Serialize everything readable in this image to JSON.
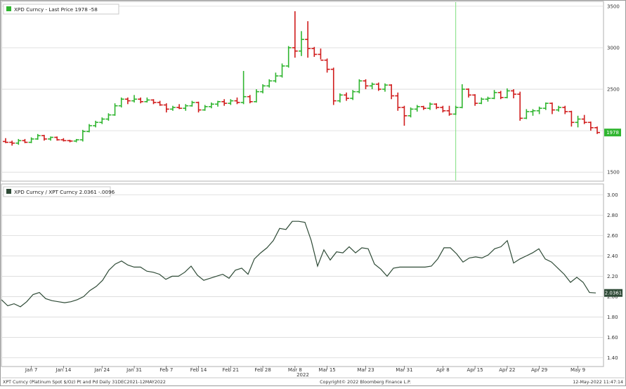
{
  "footer": {
    "left": "XPT Curncy (Platinum Spot  $/Oz) Pt and Pd  Daily 31DEC2021-12MAY2022",
    "center": "Copyright© 2022 Bloomberg Finance L.P.",
    "right": "12-May-2022 11:47:14"
  },
  "colors": {
    "up": "#2fb52f",
    "down": "#d01c1c",
    "ratio_line": "#2e4a36",
    "marker_line": "#7fe07f"
  },
  "chart_data": [
    {
      "type": "bar",
      "subtype": "ohlc",
      "title": "XPD Curncy - Last Price 1978  -58",
      "series_name": "XPD Curncy",
      "last_value_label": "1978",
      "ylim": [
        1400,
        3550
      ],
      "yticks": [
        1500,
        2000,
        2500,
        3000,
        3500
      ],
      "grid": true,
      "legend": "top-left",
      "vertical_marker_x": 70,
      "candles": [
        {
          "o": 1870,
          "h": 1910,
          "l": 1850,
          "c": 1860
        },
        {
          "o": 1860,
          "h": 1880,
          "l": 1820,
          "c": 1850
        },
        {
          "o": 1850,
          "h": 1900,
          "l": 1830,
          "c": 1880
        },
        {
          "o": 1880,
          "h": 1900,
          "l": 1850,
          "c": 1860
        },
        {
          "o": 1860,
          "h": 1920,
          "l": 1850,
          "c": 1900
        },
        {
          "o": 1900,
          "h": 1960,
          "l": 1890,
          "c": 1940
        },
        {
          "o": 1940,
          "h": 1950,
          "l": 1880,
          "c": 1900
        },
        {
          "o": 1900,
          "h": 1930,
          "l": 1880,
          "c": 1920
        },
        {
          "o": 1920,
          "h": 1930,
          "l": 1880,
          "c": 1890
        },
        {
          "o": 1890,
          "h": 1910,
          "l": 1870,
          "c": 1880
        },
        {
          "o": 1880,
          "h": 1890,
          "l": 1860,
          "c": 1875
        },
        {
          "o": 1875,
          "h": 1900,
          "l": 1860,
          "c": 1890
        },
        {
          "o": 1890,
          "h": 2010,
          "l": 1870,
          "c": 1990
        },
        {
          "o": 1990,
          "h": 2080,
          "l": 1980,
          "c": 2060
        },
        {
          "o": 2060,
          "h": 2120,
          "l": 2040,
          "c": 2100
        },
        {
          "o": 2100,
          "h": 2160,
          "l": 2080,
          "c": 2140
        },
        {
          "o": 2140,
          "h": 2210,
          "l": 2120,
          "c": 2190
        },
        {
          "o": 2190,
          "h": 2330,
          "l": 2180,
          "c": 2300
        },
        {
          "o": 2300,
          "h": 2400,
          "l": 2280,
          "c": 2380
        },
        {
          "o": 2380,
          "h": 2400,
          "l": 2320,
          "c": 2360
        },
        {
          "o": 2360,
          "h": 2430,
          "l": 2340,
          "c": 2380
        },
        {
          "o": 2380,
          "h": 2400,
          "l": 2330,
          "c": 2350
        },
        {
          "o": 2350,
          "h": 2400,
          "l": 2340,
          "c": 2370
        },
        {
          "o": 2370,
          "h": 2380,
          "l": 2320,
          "c": 2340
        },
        {
          "o": 2340,
          "h": 2360,
          "l": 2300,
          "c": 2310
        },
        {
          "o": 2310,
          "h": 2330,
          "l": 2220,
          "c": 2260
        },
        {
          "o": 2260,
          "h": 2300,
          "l": 2240,
          "c": 2280
        },
        {
          "o": 2280,
          "h": 2320,
          "l": 2260,
          "c": 2270
        },
        {
          "o": 2270,
          "h": 2320,
          "l": 2240,
          "c": 2300
        },
        {
          "o": 2300,
          "h": 2360,
          "l": 2290,
          "c": 2340
        },
        {
          "o": 2340,
          "h": 2350,
          "l": 2220,
          "c": 2250
        },
        {
          "o": 2250,
          "h": 2310,
          "l": 2240,
          "c": 2290
        },
        {
          "o": 2290,
          "h": 2340,
          "l": 2270,
          "c": 2320
        },
        {
          "o": 2320,
          "h": 2360,
          "l": 2290,
          "c": 2350
        },
        {
          "o": 2350,
          "h": 2380,
          "l": 2300,
          "c": 2330
        },
        {
          "o": 2330,
          "h": 2380,
          "l": 2310,
          "c": 2360
        },
        {
          "o": 2360,
          "h": 2400,
          "l": 2320,
          "c": 2340
        },
        {
          "o": 2340,
          "h": 2720,
          "l": 2320,
          "c": 2410
        },
        {
          "o": 2410,
          "h": 2430,
          "l": 2330,
          "c": 2350
        },
        {
          "o": 2350,
          "h": 2500,
          "l": 2340,
          "c": 2470
        },
        {
          "o": 2470,
          "h": 2560,
          "l": 2450,
          "c": 2540
        },
        {
          "o": 2540,
          "h": 2620,
          "l": 2520,
          "c": 2600
        },
        {
          "o": 2600,
          "h": 2700,
          "l": 2580,
          "c": 2660
        },
        {
          "o": 2660,
          "h": 2810,
          "l": 2640,
          "c": 2780
        },
        {
          "o": 2780,
          "h": 3020,
          "l": 2760,
          "c": 3000
        },
        {
          "o": 3000,
          "h": 3440,
          "l": 2880,
          "c": 2960
        },
        {
          "o": 2960,
          "h": 3200,
          "l": 2900,
          "c": 3100
        },
        {
          "o": 3100,
          "h": 3320,
          "l": 2880,
          "c": 2990
        },
        {
          "o": 2990,
          "h": 3010,
          "l": 2890,
          "c": 2920
        },
        {
          "o": 2920,
          "h": 2990,
          "l": 2860,
          "c": 2850
        },
        {
          "o": 2850,
          "h": 2870,
          "l": 2700,
          "c": 2740
        },
        {
          "o": 2740,
          "h": 2760,
          "l": 2310,
          "c": 2360
        },
        {
          "o": 2360,
          "h": 2450,
          "l": 2340,
          "c": 2430
        },
        {
          "o": 2430,
          "h": 2460,
          "l": 2360,
          "c": 2390
        },
        {
          "o": 2390,
          "h": 2490,
          "l": 2370,
          "c": 2470
        },
        {
          "o": 2470,
          "h": 2620,
          "l": 2450,
          "c": 2600
        },
        {
          "o": 2600,
          "h": 2620,
          "l": 2500,
          "c": 2540
        },
        {
          "o": 2540,
          "h": 2580,
          "l": 2500,
          "c": 2560
        },
        {
          "o": 2560,
          "h": 2580,
          "l": 2480,
          "c": 2500
        },
        {
          "o": 2500,
          "h": 2570,
          "l": 2470,
          "c": 2550
        },
        {
          "o": 2550,
          "h": 2560,
          "l": 2380,
          "c": 2420
        },
        {
          "o": 2420,
          "h": 2460,
          "l": 2240,
          "c": 2280
        },
        {
          "o": 2280,
          "h": 2300,
          "l": 2060,
          "c": 2180
        },
        {
          "o": 2180,
          "h": 2280,
          "l": 2160,
          "c": 2260
        },
        {
          "o": 2260,
          "h": 2310,
          "l": 2230,
          "c": 2290
        },
        {
          "o": 2290,
          "h": 2300,
          "l": 2250,
          "c": 2270
        },
        {
          "o": 2270,
          "h": 2340,
          "l": 2250,
          "c": 2320
        },
        {
          "o": 2320,
          "h": 2330,
          "l": 2260,
          "c": 2280
        },
        {
          "o": 2280,
          "h": 2300,
          "l": 2220,
          "c": 2240
        },
        {
          "o": 2240,
          "h": 2300,
          "l": 2180,
          "c": 2200
        },
        {
          "o": 2200,
          "h": 2300,
          "l": 2190,
          "c": 2280
        },
        {
          "o": 2280,
          "h": 2560,
          "l": 2270,
          "c": 2500
        },
        {
          "o": 2500,
          "h": 2510,
          "l": 2400,
          "c": 2430
        },
        {
          "o": 2430,
          "h": 2440,
          "l": 2300,
          "c": 2330
        },
        {
          "o": 2330,
          "h": 2400,
          "l": 2320,
          "c": 2380
        },
        {
          "o": 2380,
          "h": 2410,
          "l": 2350,
          "c": 2390
        },
        {
          "o": 2390,
          "h": 2490,
          "l": 2380,
          "c": 2460
        },
        {
          "o": 2460,
          "h": 2480,
          "l": 2380,
          "c": 2400
        },
        {
          "o": 2400,
          "h": 2510,
          "l": 2390,
          "c": 2480
        },
        {
          "o": 2480,
          "h": 2500,
          "l": 2390,
          "c": 2440
        },
        {
          "o": 2440,
          "h": 2470,
          "l": 2120,
          "c": 2150
        },
        {
          "o": 2150,
          "h": 2260,
          "l": 2140,
          "c": 2230
        },
        {
          "o": 2230,
          "h": 2260,
          "l": 2180,
          "c": 2240
        },
        {
          "o": 2240,
          "h": 2290,
          "l": 2200,
          "c": 2270
        },
        {
          "o": 2270,
          "h": 2340,
          "l": 2250,
          "c": 2330
        },
        {
          "o": 2330,
          "h": 2340,
          "l": 2200,
          "c": 2250
        },
        {
          "o": 2250,
          "h": 2300,
          "l": 2230,
          "c": 2280
        },
        {
          "o": 2280,
          "h": 2300,
          "l": 2200,
          "c": 2230
        },
        {
          "o": 2230,
          "h": 2240,
          "l": 2050,
          "c": 2100
        },
        {
          "o": 2100,
          "h": 2180,
          "l": 2040,
          "c": 2140
        },
        {
          "o": 2140,
          "h": 2190,
          "l": 2080,
          "c": 2100
        },
        {
          "o": 2100,
          "h": 2110,
          "l": 2000,
          "c": 2036
        },
        {
          "o": 2036,
          "h": 2050,
          "l": 1960,
          "c": 1978
        }
      ]
    },
    {
      "type": "line",
      "title": "XPD Curncy / XPT Curncy 2.0361  -.0096",
      "series_name": "XPD Curncy / XPT Curncy",
      "last_value_label": "2.0361",
      "ylim": [
        1.32,
        3.1
      ],
      "yticks": [
        "1.40",
        "1.60",
        "1.80",
        "2.00",
        "2.20",
        "2.40",
        "2.60",
        "2.80",
        "3.00"
      ],
      "grid": true,
      "legend": "top-left",
      "values": [
        1.97,
        1.91,
        1.93,
        1.9,
        1.95,
        2.02,
        2.04,
        1.98,
        1.96,
        1.95,
        1.94,
        1.95,
        1.97,
        2.0,
        2.06,
        2.1,
        2.16,
        2.26,
        2.32,
        2.35,
        2.31,
        2.29,
        2.29,
        2.25,
        2.24,
        2.22,
        2.17,
        2.2,
        2.2,
        2.24,
        2.3,
        2.21,
        2.16,
        2.18,
        2.2,
        2.22,
        2.18,
        2.26,
        2.28,
        2.22,
        2.37,
        2.43,
        2.48,
        2.55,
        2.67,
        2.66,
        2.74,
        2.74,
        2.73,
        2.55,
        2.3,
        2.46,
        2.36,
        2.44,
        2.43,
        2.49,
        2.43,
        2.48,
        2.47,
        2.32,
        2.27,
        2.2,
        2.28,
        2.29,
        2.29,
        2.29,
        2.29,
        2.29,
        2.3,
        2.37,
        2.48,
        2.48,
        2.42,
        2.34,
        2.38,
        2.39,
        2.38,
        2.41,
        2.47,
        2.49,
        2.55,
        2.33,
        2.37,
        2.4,
        2.43,
        2.47,
        2.37,
        2.34,
        2.28,
        2.22,
        2.14,
        2.19,
        2.14,
        2.04,
        2.0361
      ]
    }
  ],
  "x_axis": {
    "ticks": [
      {
        "label": "Jan 7",
        "i": 4
      },
      {
        "label": "Jan 14",
        "i": 9
      },
      {
        "label": "Jan 24",
        "i": 15
      },
      {
        "label": "Jan 31",
        "i": 20
      },
      {
        "label": "Feb 7",
        "i": 25
      },
      {
        "label": "Feb 14",
        "i": 30
      },
      {
        "label": "Feb 21",
        "i": 35
      },
      {
        "label": "Feb 28",
        "i": 40
      },
      {
        "label": "Mar 8",
        "i": 45
      },
      {
        "label": "Mar 15",
        "i": 50
      },
      {
        "label": "Mar 23",
        "i": 56
      },
      {
        "label": "Mar 31",
        "i": 62
      },
      {
        "label": "Apr 8",
        "i": 68
      },
      {
        "label": "Apr 15",
        "i": 73
      },
      {
        "label": "Apr 22",
        "i": 78
      },
      {
        "label": "Apr 29",
        "i": 83
      },
      {
        "label": "May 9",
        "i": 89
      }
    ],
    "year": "2022"
  }
}
